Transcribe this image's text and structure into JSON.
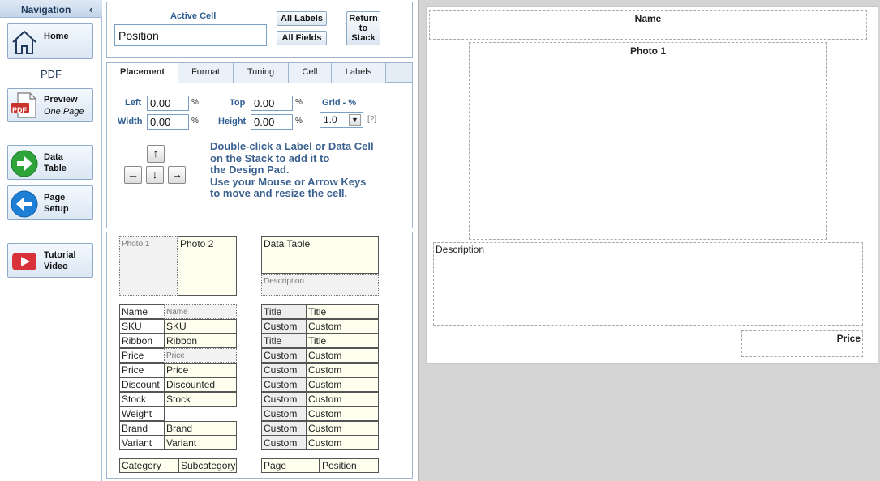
{
  "nav": {
    "title": "Navigation",
    "collapse_glyph": "‹",
    "home": "Home",
    "pdf_heading": "PDF",
    "preview": "Preview",
    "preview_sub": "One Page",
    "data_table_1": "Data",
    "data_table_2": "Table",
    "page_setup_1": "Page",
    "page_setup_2": "Setup",
    "tutorial_1": "Tutorial",
    "tutorial_2": "Video",
    "pdf_icon_text": "PDF"
  },
  "active_cell": {
    "label": "Active Cell",
    "value": "Position",
    "all_labels": "All Labels",
    "all_fields": "All Fields",
    "return_1": "Return",
    "return_2": "to",
    "return_3": "Stack"
  },
  "tabs": [
    "Placement",
    "Format",
    "Tuning",
    "Cell",
    "Labels"
  ],
  "placement": {
    "left_label": "Left",
    "left_value": "0.00",
    "width_label": "Width",
    "width_value": "0.00",
    "top_label": "Top",
    "top_value": "0.00",
    "height_label": "Height",
    "height_value": "0.00",
    "pct": "%",
    "grid_label": "Grid - %",
    "grid_value": "1.0",
    "grid_help": "[?]",
    "help_text_1": "Double-click a Label or Data Cell",
    "help_text_2": "on the Stack to add it to",
    "help_text_3": "the Design Pad.",
    "help_text_4": "Use your Mouse or Arrow Keys",
    "help_text_5": "to move and resize the cell.",
    "arrow_up": "↑",
    "arrow_left": "←",
    "arrow_down": "↓",
    "arrow_right": "→"
  },
  "stack": {
    "photo1": "Photo 1",
    "photo2": "Photo 2",
    "data_table": "Data Table",
    "description": "Description",
    "left_rows": [
      [
        "Name",
        "Name"
      ],
      [
        "SKU",
        "SKU"
      ],
      [
        "Ribbon",
        "Ribbon"
      ],
      [
        "Price",
        "Price"
      ],
      [
        "Price",
        "Price"
      ],
      [
        "Discount",
        "Discounted"
      ],
      [
        "Stock",
        "Stock"
      ],
      [
        "Weight",
        ""
      ],
      [
        "Brand",
        "Brand"
      ],
      [
        "Variant",
        "Variant"
      ]
    ],
    "right_rows": [
      [
        "Title",
        "Title"
      ],
      [
        "Custom",
        "Custom"
      ],
      [
        "Title",
        "Title"
      ],
      [
        "Custom",
        "Custom"
      ],
      [
        "Custom",
        "Custom"
      ],
      [
        "Custom",
        "Custom"
      ],
      [
        "Custom",
        "Custom"
      ],
      [
        "Custom",
        "Custom"
      ],
      [
        "Custom",
        "Custom"
      ],
      [
        "Custom",
        "Custom"
      ]
    ],
    "category": "Category",
    "subcategory": "Subcategory",
    "page": "Page",
    "position": "Position"
  },
  "pad": {
    "name": "Name",
    "photo1": "Photo 1",
    "description": "Description",
    "price": "Price"
  },
  "colors": {
    "accent": "#2e5e92",
    "home_icon": "#1f3a5a",
    "data_table_icon": "#2ea43a",
    "page_setup_icon": "#1e7fd6",
    "tutorial_icon": "#d8323a",
    "pdf_icon": "#c8332b"
  }
}
